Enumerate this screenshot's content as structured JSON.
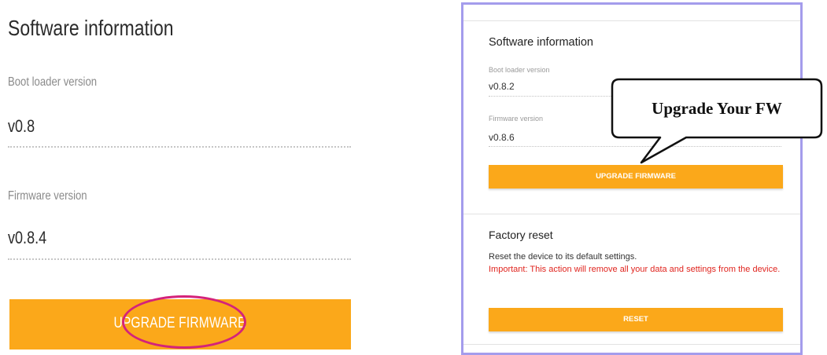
{
  "left": {
    "title": "Software information",
    "boot_loader_label": "Boot loader version",
    "boot_loader_value": "v0.8",
    "firmware_label": "Firmware version",
    "firmware_value": "v0.8.4",
    "upgrade_button": "UPGRADE FIRMWARE"
  },
  "right": {
    "title": "Software information",
    "boot_loader_label": "Boot loader version",
    "boot_loader_value": "v0.8.2",
    "firmware_label": "Firmware version",
    "firmware_value": "v0.8.6",
    "upgrade_button": "UPGRADE FIRMWARE",
    "factory_reset_title": "Factory reset",
    "factory_reset_desc": "Reset the device to its default settings.",
    "factory_reset_warning": "Important: This action will remove all your data and settings from the device.",
    "reset_button": "RESET"
  },
  "callout": {
    "text": "Upgrade Your FW"
  },
  "colors": {
    "accent": "#fba81a",
    "highlight": "#d4237a",
    "frame": "#a49cec",
    "warning": "#e0251f"
  }
}
